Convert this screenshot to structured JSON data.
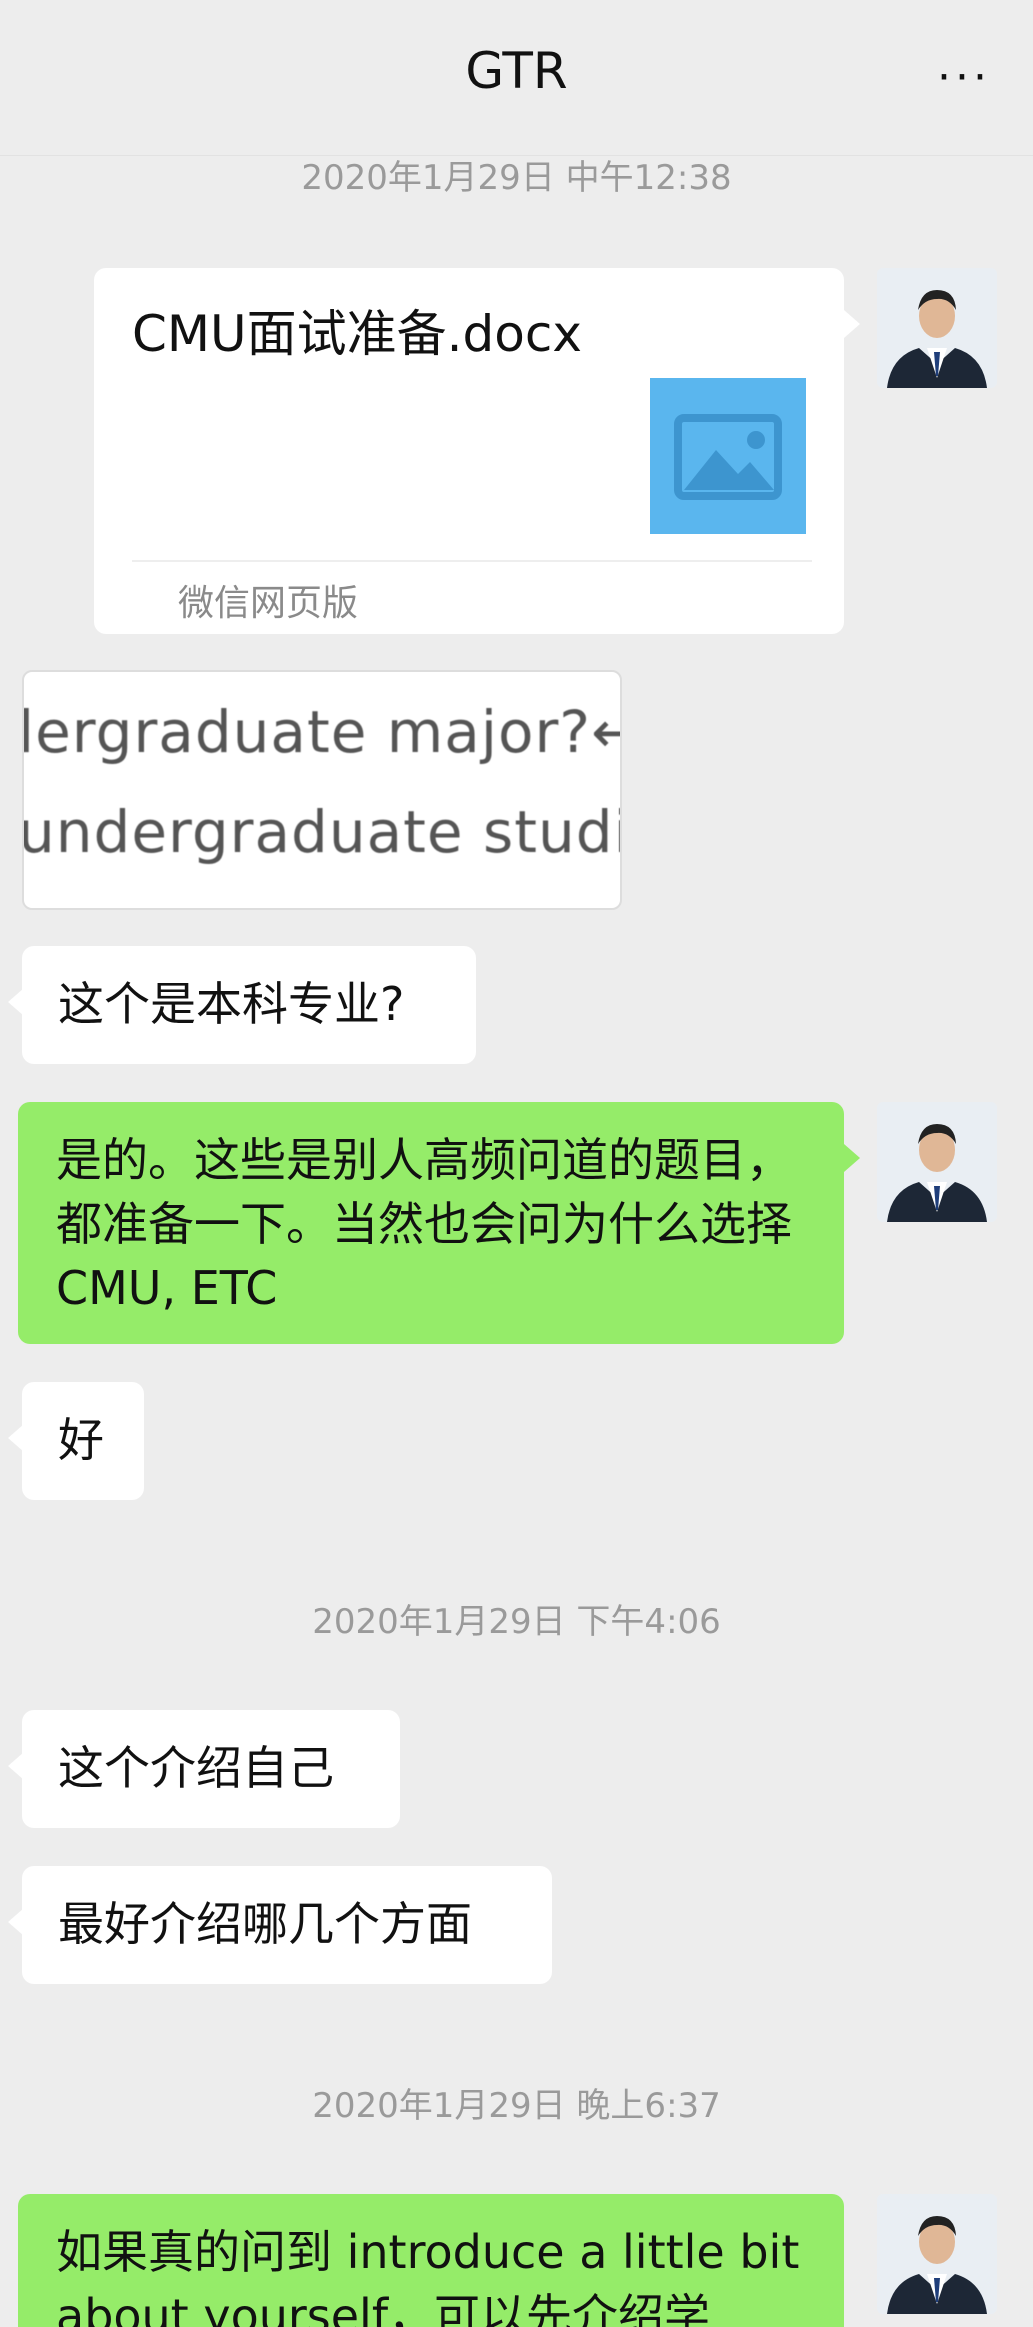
{
  "header": {
    "title": "GTR",
    "more_label": "···"
  },
  "messages": {
    "ts1": "2020年1月29日 中午12:38",
    "file": {
      "name": "CMU面试准备.docx",
      "source": "微信网页版"
    },
    "image_msg": {
      "line1": "lergraduate major?↵",
      "line2": "undergraduate studi"
    },
    "m1": "这个是本科专业?",
    "m2": "是的。这些是别人高频问道的题目，都准备一下。当然也会问为什么选择 CMU, ETC",
    "m3": "好",
    "ts2": "2020年1月29日 下午4:06",
    "m4": "这个介绍自己",
    "m5": "最好介绍哪几个方面",
    "ts3": "2020年1月29日 晚上6:37",
    "m6": "如果真的问到 introduce a little bit about yourself，可以先介绍学"
  },
  "colors": {
    "green_bubble": "#95ec69",
    "background": "#ededed",
    "white_bubble": "#ffffff"
  },
  "icons": {
    "more": "more-dots-icon",
    "image": "image-placeholder-icon",
    "avatar": "avatar-icon"
  }
}
